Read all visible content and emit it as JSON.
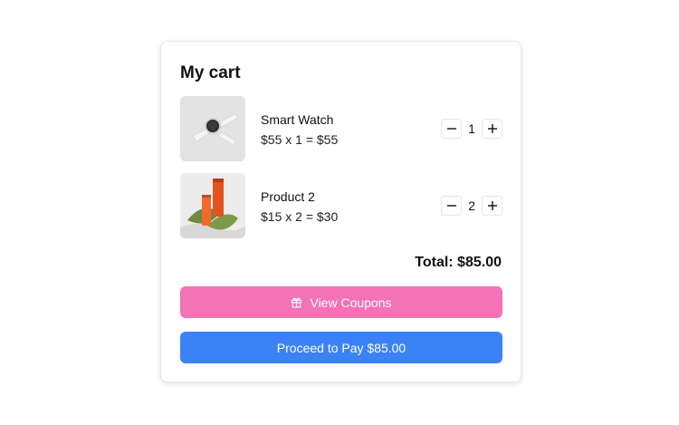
{
  "cart": {
    "title": "My cart",
    "items": [
      {
        "name": "Smart Watch",
        "price_line": "$55 x 1 = $55",
        "quantity": "1",
        "image": "smart-watch-photo"
      },
      {
        "name": "Product 2",
        "price_line": "$15 x 2 = $30",
        "quantity": "2",
        "image": "orange-tube-product-photo"
      }
    ],
    "total": "Total: $85.00",
    "coupons_label": "View Coupons",
    "pay_label": "Proceed to Pay $85.00",
    "icons": {
      "decrease": "minus-icon",
      "increase": "plus-icon",
      "coupons": "gift-icon"
    },
    "colors": {
      "coupons_button": "#f472b6",
      "pay_button": "#3b82f6"
    }
  }
}
